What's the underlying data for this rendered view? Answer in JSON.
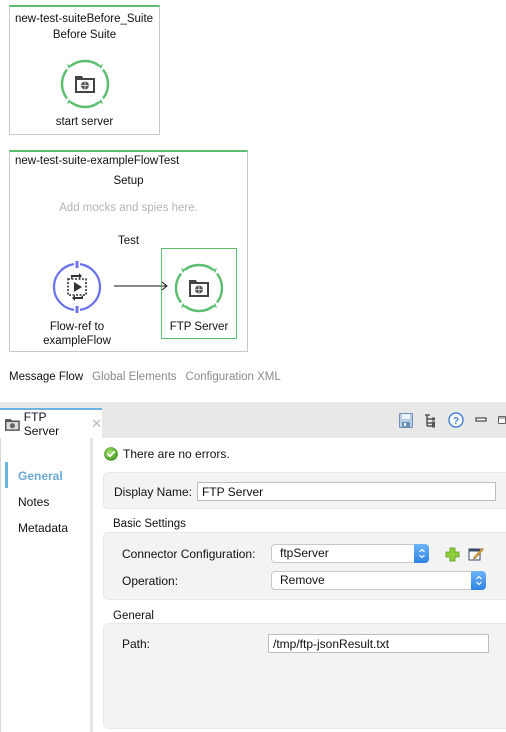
{
  "canvas": {
    "before_suite": {
      "title": "new-test-suiteBefore_Suite",
      "section": "Before Suite",
      "node": {
        "label": "start server",
        "icon": "ftp-folder-globe-icon",
        "color": "#5bbf6f"
      }
    },
    "test_case": {
      "title": "new-test-suite-exampleFlowTest",
      "setup_label": "Setup",
      "setup_hint": "Add mocks and spies here.",
      "test_label": "Test",
      "flow_ref": {
        "label_line1": "Flow-ref to",
        "label_line2": "exampleFlow",
        "icon": "flow-ref-icon",
        "color": "#6b72ea"
      },
      "ftp_node": {
        "label": "FTP Server",
        "icon": "ftp-folder-globe-icon",
        "color": "#5bbf6f"
      }
    }
  },
  "editor_tabs": [
    {
      "label": "Message Flow",
      "active": true
    },
    {
      "label": "Global Elements",
      "active": false
    },
    {
      "label": "Configuration XML",
      "active": false
    }
  ],
  "properties": {
    "tab_label": "FTP Server",
    "toolbar": [
      "save-icon",
      "tree-icon",
      "help-icon",
      "minimize-icon",
      "maximize-icon"
    ],
    "side_nav": [
      {
        "label": "General",
        "active": true
      },
      {
        "label": "Notes",
        "active": false
      },
      {
        "label": "Metadata",
        "active": false
      }
    ],
    "status_text": "There are no errors.",
    "display_name_label": "Display Name:",
    "display_name_value": "FTP Server",
    "basic_settings": {
      "title": "Basic Settings",
      "connector_config_label": "Connector Configuration:",
      "connector_config_value": "ftpServer",
      "operation_label": "Operation:",
      "operation_value": "Remove"
    },
    "general": {
      "title": "General",
      "path_label": "Path:",
      "path_value": "/tmp/ftp-jsonResult.txt"
    }
  },
  "colors": {
    "scope_border_top": "#5bbf6f",
    "accent_blue": "#6ab4de",
    "flow_ref": "#6b72ea",
    "connector_green": "#5bbf6f"
  }
}
